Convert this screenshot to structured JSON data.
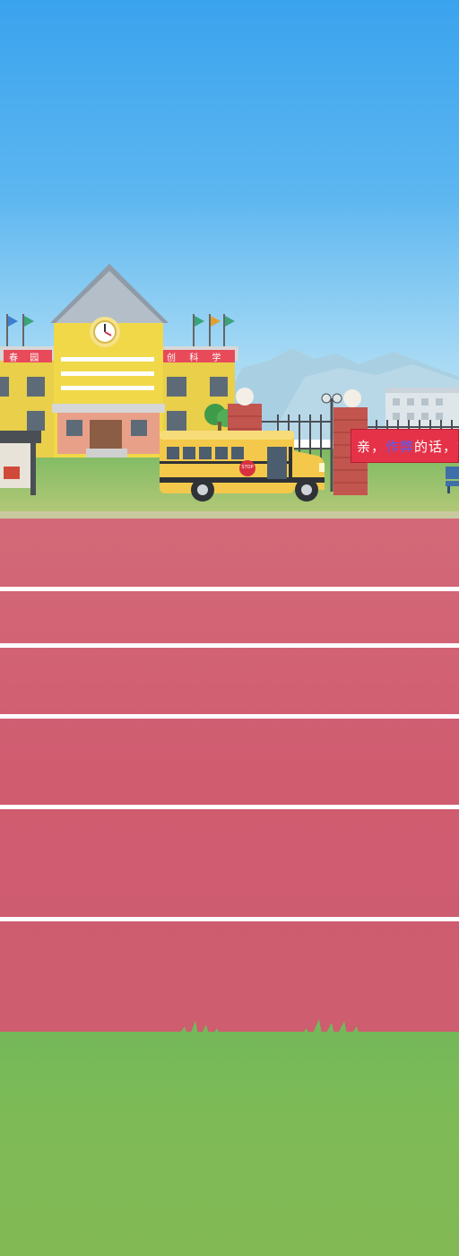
{
  "scene": {
    "banner": {
      "prefix": "亲，",
      "highlight": "作弊",
      "suffix": "的话，如"
    },
    "bus": {
      "stop_sign": "STOP"
    },
    "school": {
      "signs": [
        "春",
        "园",
        "创",
        "科",
        "学"
      ]
    },
    "colors": {
      "sky_top": "#3aa3ee",
      "track": "#d05c70",
      "lane_line": "#ffffff",
      "grass": "#7ebb56",
      "banner": "#e63248",
      "bus": "#f4c84a"
    }
  }
}
